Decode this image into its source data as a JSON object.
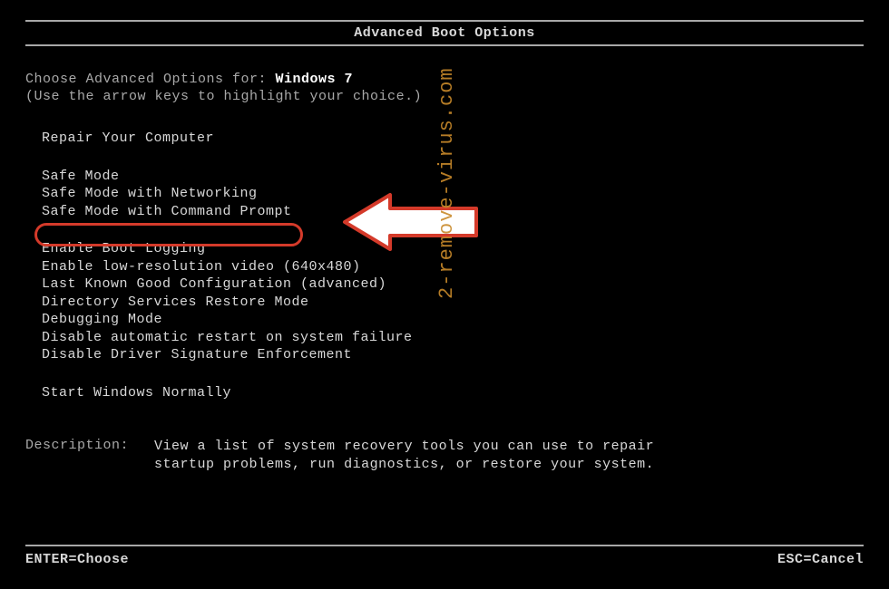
{
  "title": "Advanced Boot Options",
  "intro": {
    "prefix": "Choose Advanced Options for: ",
    "os": "Windows 7",
    "hint": "(Use the arrow keys to highlight your choice.)"
  },
  "menu": {
    "group1": [
      "Repair Your Computer"
    ],
    "group2": [
      "Safe Mode",
      "Safe Mode with Networking",
      "Safe Mode with Command Prompt"
    ],
    "group3": [
      "Enable Boot Logging",
      "Enable low-resolution video (640x480)",
      "Last Known Good Configuration (advanced)",
      "Directory Services Restore Mode",
      "Debugging Mode",
      "Disable automatic restart on system failure",
      "Disable Driver Signature Enforcement"
    ],
    "group4": [
      "Start Windows Normally"
    ],
    "highlighted_item": "Safe Mode with Command Prompt"
  },
  "description": {
    "label": "Description:",
    "text": "View a list of system recovery tools you can use to repair startup problems, run diagnostics, or restore your system."
  },
  "footer": {
    "left": "ENTER=Choose",
    "right": "ESC=Cancel"
  },
  "watermark": "2-remove-virus.com",
  "annotation": {
    "arrow_color": "#ffffff",
    "arrow_border": "#d43a2a",
    "ring_color": "#d43a2a"
  }
}
